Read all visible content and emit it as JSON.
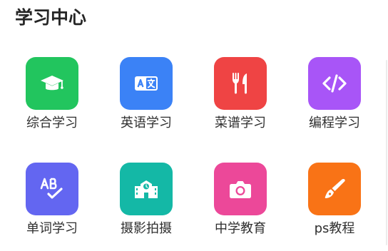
{
  "section": {
    "title": "学习中心"
  },
  "tiles": [
    {
      "label": "综合学习",
      "icon": "graduation-cap-icon",
      "color": "#22c55e"
    },
    {
      "label": "英语学习",
      "icon": "translate-icon",
      "color": "#3b82f6"
    },
    {
      "label": "菜谱学习",
      "icon": "utensils-icon",
      "color": "#ef4444"
    },
    {
      "label": "编程学习",
      "icon": "code-icon",
      "color": "#a855f7"
    },
    {
      "label": "单词学习",
      "icon": "spell-check-icon",
      "color": "#6366f1"
    },
    {
      "label": "摄影拍摄",
      "icon": "school-icon",
      "color": "#14b8a6"
    },
    {
      "label": "中学教育",
      "icon": "camera-icon",
      "color": "#ec4899"
    },
    {
      "label": "ps教程",
      "icon": "brush-icon",
      "color": "#f97316"
    }
  ]
}
